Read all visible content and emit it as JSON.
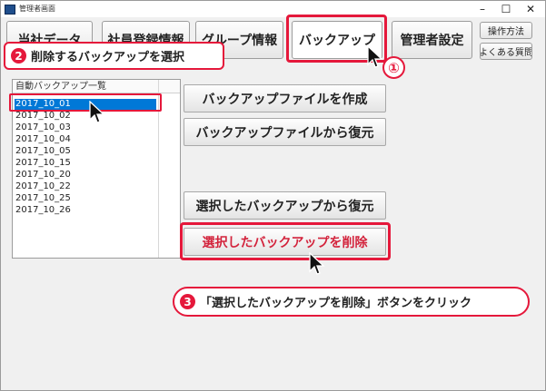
{
  "window": {
    "title": "管理者画面",
    "minimize": "–",
    "maximize": "☐",
    "close": "✕"
  },
  "tabs": {
    "t1": "当社データ",
    "t2": "社員登録情報",
    "t3": "グループ情報",
    "t4": "バックアップ",
    "t5": "管理者設定",
    "help": "操作方法",
    "faq": "よくある質問"
  },
  "backup_list": {
    "header": "自動バックアップ一覧",
    "items": [
      "2017_10_01",
      "2017_10_02",
      "2017_10_03",
      "2017_10_04",
      "2017_10_05",
      "2017_10_15",
      "2017_10_20",
      "2017_10_22",
      "2017_10_25",
      "2017_10_26"
    ],
    "selected": "2017_10_01"
  },
  "buttons": {
    "create": "バックアップファイルを作成",
    "restore_file": "バックアップファイルから復元",
    "restore_selected": "選択したバックアップから復元",
    "delete_selected": "選択したバックアップを削除"
  },
  "annotations": {
    "step1": "①",
    "step2_num": "2",
    "step2_text": "削除するバックアップを選択",
    "step3_num": "3",
    "step3_text": "「選択したバックアップを削除」ボタンをクリック",
    "accent_color": "#e5183b"
  }
}
